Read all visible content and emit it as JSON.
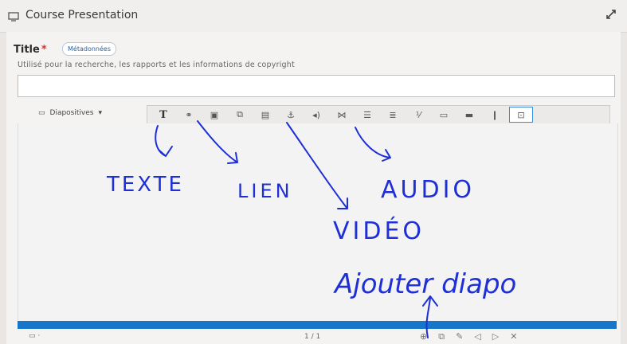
{
  "header": {
    "title": "Course Presentation"
  },
  "field": {
    "label": "Title",
    "required_mark": "*",
    "metadata_button": "Métadonnées",
    "help": "Utilisé pour la recherche, les rapports et les informations de copyright",
    "value": ""
  },
  "toolbar": {
    "slides_dropdown": "Diapositives",
    "text_button": "T"
  },
  "footer": {
    "page": "1 / 1"
  },
  "annotations": {
    "texte": "TEXTE",
    "lien": "LIEN",
    "audio": "AUDIO",
    "video": "VIDÉO",
    "ajouter": "Ajouter diapo"
  },
  "colors": {
    "ink": "#1e2fd6",
    "progress": "#1676c9",
    "required": "#d9302b"
  }
}
